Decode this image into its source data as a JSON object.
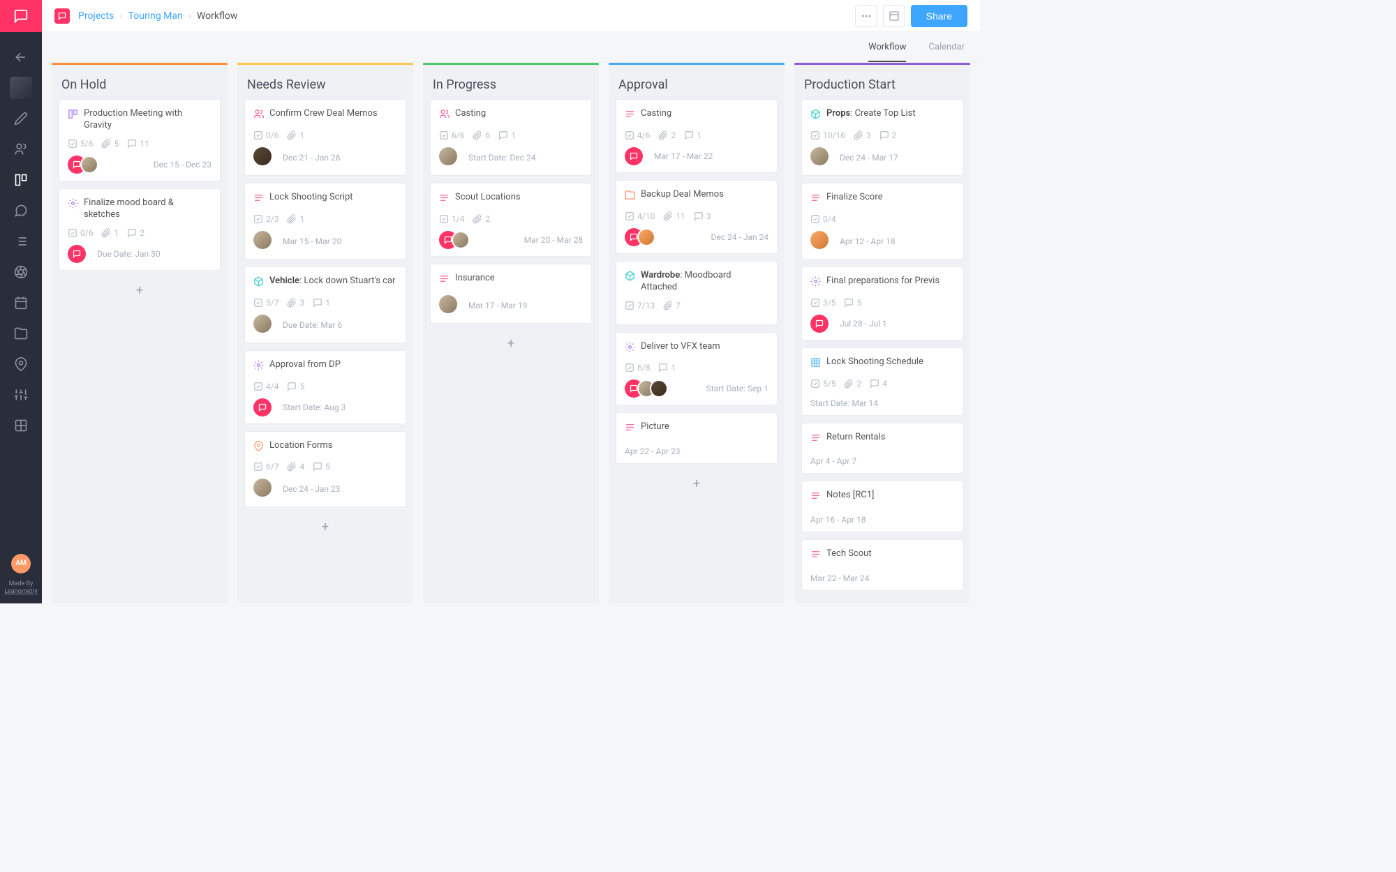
{
  "breadcrumb": {
    "l1": "Projects",
    "l2": "Touring Man",
    "l3": "Workflow"
  },
  "share_label": "Share",
  "tabs": {
    "workflow": "Workflow",
    "calendar": "Calendar"
  },
  "made_by": {
    "line1": "Made By",
    "line2": "Leanometry"
  },
  "user_initials": "AM",
  "columns": [
    {
      "id": "on-hold",
      "title": "On Hold",
      "color": "#ff8c3b",
      "cards": [
        {
          "icon": "board",
          "iconClass": "ic-purple",
          "title_html": "Production Meeting with Gravity",
          "checks": "5/6",
          "attach": "5",
          "comments": "11",
          "avatars": [
            "pink",
            "person"
          ],
          "date": "Dec 15 - Dec 23"
        },
        {
          "icon": "gear",
          "iconClass": "ic-purple",
          "title_html": "Finalize mood board & sketches",
          "checks": "0/6",
          "attach": "1",
          "comments": "2",
          "avatars": [
            "pink"
          ],
          "date": "Due Date: Jan 30",
          "dateLeft": true
        }
      ]
    },
    {
      "id": "needs-review",
      "title": "Needs Review",
      "color": "#f8c84e",
      "cards": [
        {
          "icon": "people",
          "iconClass": "ic-pink",
          "title_html": "Confirm Crew Deal Memos",
          "checks": "0/6",
          "attach": "1",
          "avatars": [
            "dark"
          ],
          "date": "Dec 21 - Jan 26",
          "dateLeft": true
        },
        {
          "icon": "stack",
          "iconClass": "ic-pink",
          "title_html": "Lock Shooting Script",
          "checks": "2/3",
          "attach": "1",
          "avatars": [
            "person"
          ],
          "date": "Mar 15 - Mar 20",
          "dateLeft": true
        },
        {
          "icon": "box",
          "iconClass": "ic-teal",
          "title_html": "<b>Vehicle</b>: Lock down Stuart's car",
          "checks": "5/7",
          "attach": "3",
          "comments": "1",
          "avatars": [
            "person"
          ],
          "date": "Due Date: Mar 6",
          "dateLeft": true
        },
        {
          "icon": "gear",
          "iconClass": "ic-purple",
          "title_html": "Approval from DP",
          "checks": "4/4",
          "comments": "5",
          "avatars": [
            "pink"
          ],
          "date": "Start Date: Aug 3",
          "dateLeft": true
        },
        {
          "icon": "pin",
          "iconClass": "ic-orange",
          "title_html": "Location Forms",
          "checks": "6/7",
          "attach": "4",
          "comments": "5",
          "avatars": [
            "person"
          ],
          "date": "Dec 24 - Jan 23",
          "dateLeft": true
        }
      ]
    },
    {
      "id": "in-progress",
      "title": "In Progress",
      "color": "#4cc96b",
      "cards": [
        {
          "icon": "people",
          "iconClass": "ic-pink",
          "title_html": "Casting",
          "checks": "6/6",
          "attach": "6",
          "comments": "1",
          "avatars": [
            "person"
          ],
          "date": "Start Date: Dec 24",
          "dateLeft": true
        },
        {
          "icon": "stack",
          "iconClass": "ic-pink",
          "title_html": "Scout Locations",
          "checks": "1/4",
          "attach": "2",
          "avatars": [
            "pink",
            "person"
          ],
          "date": "Mar 20 - Mar 28"
        },
        {
          "icon": "stack",
          "iconClass": "ic-pink",
          "title_html": "Insurance",
          "avatars": [
            "person"
          ],
          "date": "Mar 17 - Mar 19",
          "dateLeft": true
        }
      ]
    },
    {
      "id": "approval",
      "title": "Approval",
      "color": "#4ba7ee",
      "cards": [
        {
          "icon": "stack",
          "iconClass": "ic-pink",
          "title_html": "Casting",
          "checks": "4/6",
          "attach": "2",
          "comments": "1",
          "avatars": [
            "pink"
          ],
          "date": "Mar 17 - Mar 22",
          "dateLeft": true
        },
        {
          "icon": "folder",
          "iconClass": "ic-folder",
          "title_html": "Backup Deal Memos",
          "checks": "4/10",
          "attach": "11",
          "comments": "3",
          "avatars": [
            "pink",
            "orange"
          ],
          "date": "Dec 24 - Jan 24"
        },
        {
          "icon": "box",
          "iconClass": "ic-teal",
          "title_html": "<b>Wardrobe</b>: Moodboard Attached",
          "checks": "7/13",
          "attach": "7"
        },
        {
          "icon": "gear",
          "iconClass": "ic-purple",
          "title_html": "Deliver to VFX team",
          "checks": "6/8",
          "comments": "1",
          "avatars": [
            "pink",
            "person",
            "dark"
          ],
          "date": "Start Date: Sep 1"
        },
        {
          "icon": "stack",
          "iconClass": "ic-pink",
          "title_html": "Picture",
          "date": "Apr 22 - Apr 23",
          "datePlain": true
        }
      ]
    },
    {
      "id": "production-start",
      "title": "Production Start",
      "color": "#8c5fd9",
      "cards": [
        {
          "icon": "box",
          "iconClass": "ic-teal",
          "title_html": "<b>Props</b>: Create Top List",
          "checks": "10/16",
          "attach": "3",
          "comments": "2",
          "avatars": [
            "person"
          ],
          "date": "Dec 24 - Mar 17",
          "dateLeft": true
        },
        {
          "icon": "stack",
          "iconClass": "ic-pink",
          "title_html": "Finalize Score",
          "checks": "0/4",
          "avatars": [
            "orange"
          ],
          "date": "Apr 12 - Apr 18",
          "dateLeft": true
        },
        {
          "icon": "gear",
          "iconClass": "ic-purple",
          "title_html": "Final preparations for Previs",
          "checks": "3/5",
          "comments": "5",
          "avatars": [
            "pink"
          ],
          "date": "Jul 28 - Jul 1",
          "dateLeft": true
        },
        {
          "icon": "grid",
          "iconClass": "ic-blue",
          "title_html": "Lock Shooting Schedule",
          "checks": "5/5",
          "attach": "2",
          "comments": "4",
          "date": "Start Date: Mar 14",
          "datePlain": true
        },
        {
          "icon": "stack",
          "iconClass": "ic-pink",
          "title_html": "Return Rentals",
          "date": "Apr 4 - Apr 7",
          "datePlain": true
        },
        {
          "icon": "stack",
          "iconClass": "ic-pink",
          "title_html": "Notes [RC1]",
          "date": "Apr 16 - Apr 18",
          "datePlain": true
        },
        {
          "icon": "stack",
          "iconClass": "ic-pink",
          "title_html": "Tech Scout",
          "date": "Mar 22 - Mar 24",
          "datePlain": true
        }
      ]
    }
  ]
}
